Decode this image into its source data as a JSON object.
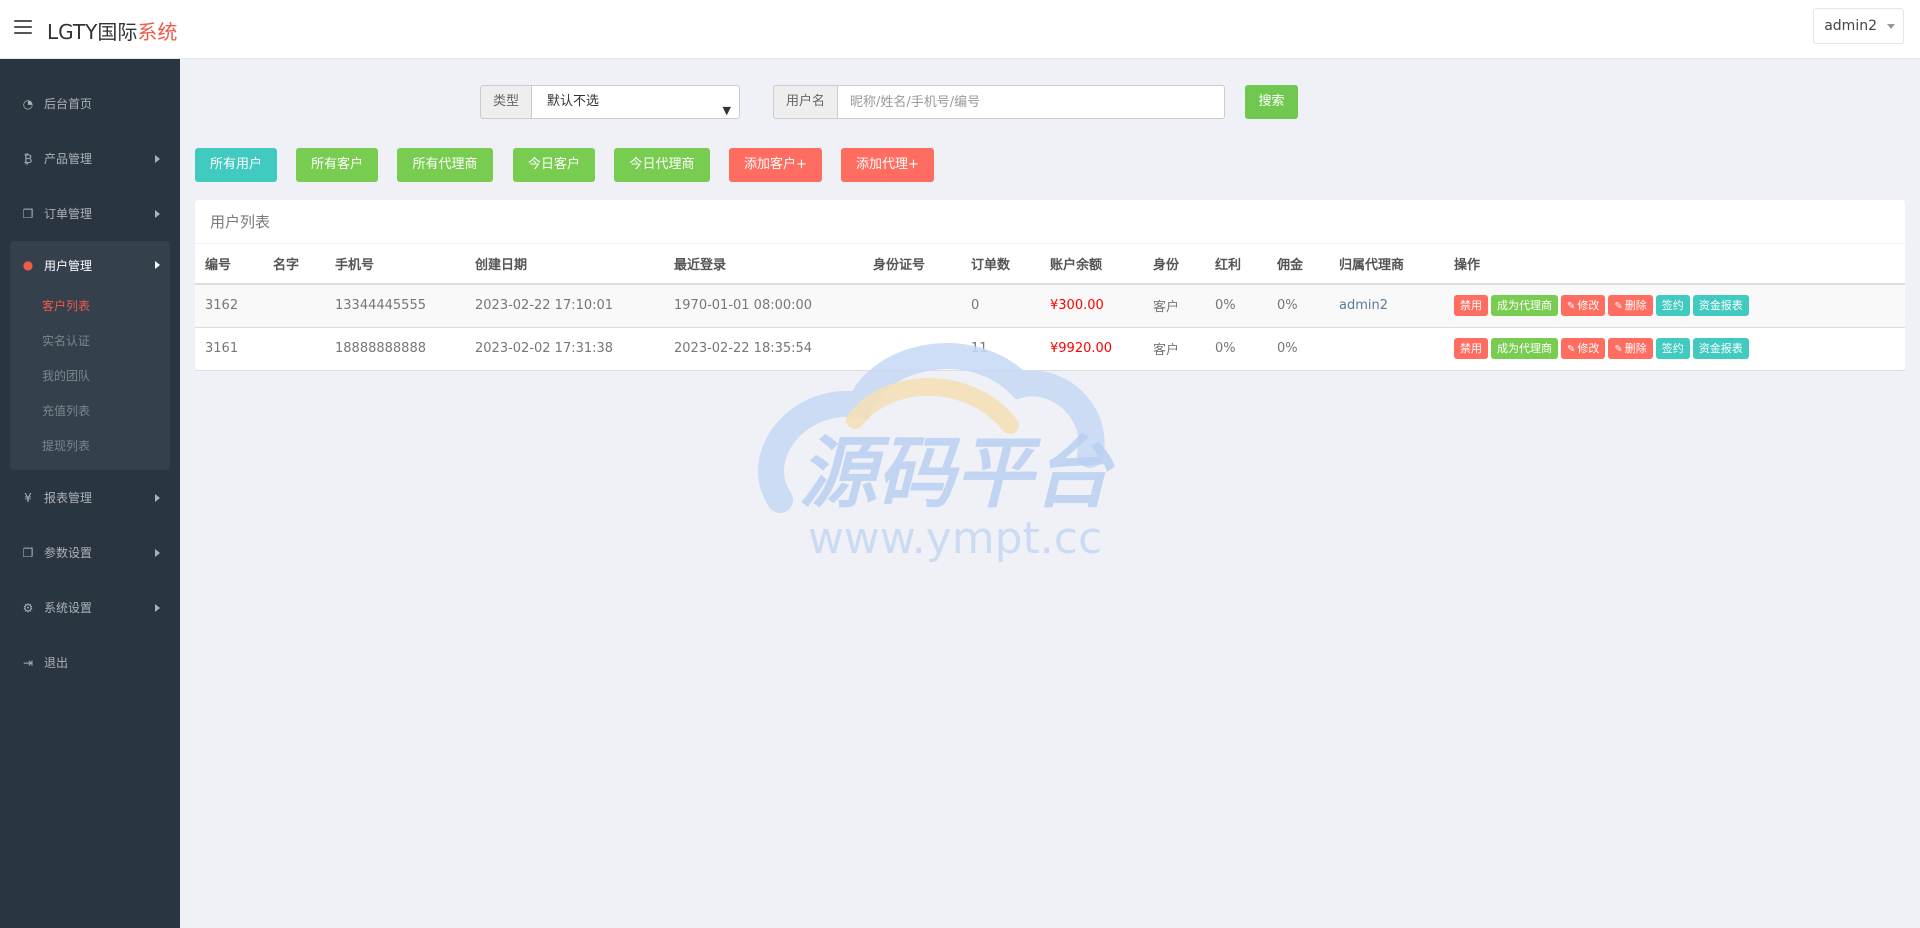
{
  "header": {
    "brand_main": "LGTY国际",
    "brand_accent": "系统",
    "user": "admin2"
  },
  "sidebar": {
    "items": [
      {
        "label": "后台首页",
        "icon": "dashboard-icon"
      },
      {
        "label": "产品管理",
        "icon": "bitcoin-icon"
      },
      {
        "label": "订单管理",
        "icon": "copy-icon"
      }
    ],
    "active_group": {
      "label": "用户管理",
      "icon": "user-icon",
      "children": [
        {
          "label": "客户列表",
          "active": true
        },
        {
          "label": "实名认证"
        },
        {
          "label": "我的团队"
        },
        {
          "label": "充值列表"
        },
        {
          "label": "提现列表"
        }
      ]
    },
    "items_after": [
      {
        "label": "报表管理",
        "icon": "yen-icon"
      },
      {
        "label": "参数设置",
        "icon": "copy-icon"
      },
      {
        "label": "系统设置",
        "icon": "gears-icon"
      },
      {
        "label": "退出",
        "icon": "sign-out-icon"
      }
    ]
  },
  "filter": {
    "type_label": "类型",
    "type_value": "默认不选",
    "username_label": "用户名",
    "username_placeholder": "昵称/姓名/手机号/编号",
    "search_label": "搜索"
  },
  "buttons": {
    "all_users": "所有用户",
    "all_customers": "所有客户",
    "all_agents": "所有代理商",
    "today_customers": "今日客户",
    "today_agents": "今日代理商",
    "add_customer": "添加客户+",
    "add_agent": "添加代理+"
  },
  "panel": {
    "title": "用户列表",
    "columns": [
      "编号",
      "名字",
      "手机号",
      "创建日期",
      "最近登录",
      "身份证号",
      "订单数",
      "账户余额",
      "身份",
      "红利",
      "佣金",
      "归属代理商",
      "操作"
    ],
    "rows": [
      {
        "id": "3162",
        "name": "",
        "phone": "13344445555",
        "created": "2023-02-22 17:10:01",
        "last_login": "1970-01-01 08:00:00",
        "id_card": "",
        "orders": "0",
        "balance": "¥300.00",
        "role": "客户",
        "bonus": "0%",
        "commission": "0%",
        "agent": "admin2"
      },
      {
        "id": "3161",
        "name": "",
        "phone": "18888888888",
        "created": "2023-02-02 17:31:38",
        "last_login": "2023-02-22 18:35:54",
        "id_card": "",
        "orders": "11",
        "balance": "¥9920.00",
        "role": "客户",
        "bonus": "0%",
        "commission": "0%",
        "agent": ""
      }
    ],
    "actions": {
      "disable": "禁用",
      "make_agent": "成为代理商",
      "edit": "修改",
      "delete": "删除",
      "sign": "签约",
      "fund_report": "资金报表"
    }
  },
  "watermark": {
    "title": "源码平台",
    "url": "www.ympt.cc"
  },
  "colors": {
    "sidebar_bg": "#2a3542",
    "accent_red": "#ff6c60",
    "cyan": "#41cac0",
    "green": "#78cd51"
  }
}
